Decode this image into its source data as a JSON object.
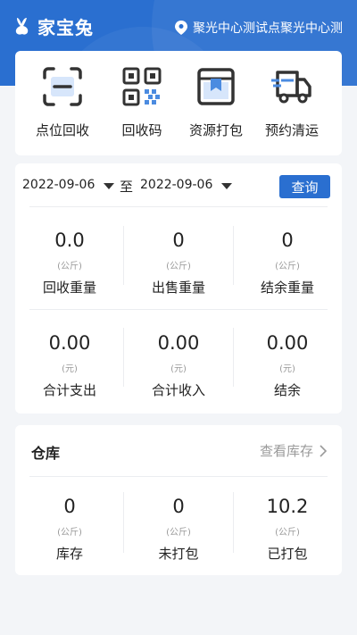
{
  "app": {
    "name": "家宝兔",
    "location": "聚光中心测试点聚光中心测"
  },
  "tools": [
    {
      "label": "点位回收",
      "icon": "scan-icon"
    },
    {
      "label": "回收码",
      "icon": "qrcode-icon"
    },
    {
      "label": "资源打包",
      "icon": "package-icon"
    },
    {
      "label": "预约清运",
      "icon": "truck-icon"
    }
  ],
  "filter": {
    "start_date": "2022-09-06",
    "to_label": "至",
    "end_date": "2022-09-06",
    "query_label": "查询"
  },
  "weight_stats": [
    {
      "value": "0.0",
      "unit": "(公斤)",
      "label": "回收重量"
    },
    {
      "value": "0",
      "unit": "(公斤)",
      "label": "出售重量"
    },
    {
      "value": "0",
      "unit": "(公斤)",
      "label": "结余重量"
    }
  ],
  "money_stats": [
    {
      "value": "0.00",
      "unit": "(元)",
      "label": "合计支出"
    },
    {
      "value": "0.00",
      "unit": "(元)",
      "label": "合计收入"
    },
    {
      "value": "0.00",
      "unit": "(元)",
      "label": "结余"
    }
  ],
  "warehouse": {
    "title": "仓库",
    "link_label": "查看库存",
    "stats": [
      {
        "value": "0",
        "unit": "(公斤)",
        "label": "库存"
      },
      {
        "value": "0",
        "unit": "(公斤)",
        "label": "未打包"
      },
      {
        "value": "10.2",
        "unit": "(公斤)",
        "label": "已打包"
      }
    ]
  },
  "colors": {
    "primary": "#2a6fd0",
    "background": "#f3f5f8"
  }
}
